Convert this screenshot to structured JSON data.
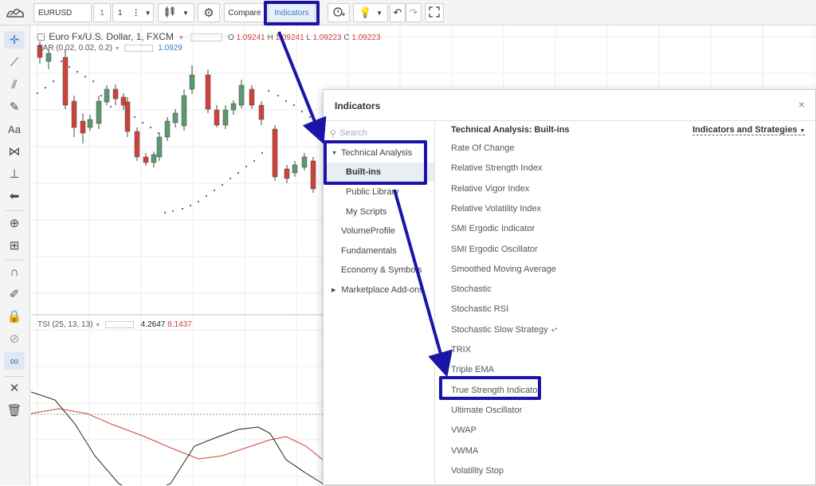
{
  "toolbar": {
    "symbol": "EURUSD",
    "interval_1": "1",
    "interval_2": "1",
    "compare_label": "Compare",
    "indicators_label": "Indicators"
  },
  "chart": {
    "title": "Euro Fx/U.S. Dollar, 1, FXCM",
    "open_label": "O",
    "open_value": "1.09241",
    "high_label": "H",
    "high_value": "1.09241",
    "low_label": "L",
    "low_value": "1.09223",
    "close_label": "C",
    "close_value": "1.09223",
    "sar_label": "SAR (0.02, 0.02, 0.2)",
    "sar_value": "1.0929",
    "tsi_label": "TSI (25, 13, 13)",
    "tsi_value_1": "4.2647",
    "tsi_value_2": "8.1437",
    "colors": {
      "up": "#5a9a6e",
      "down": "#d0413a",
      "sar": "#1f6f8b",
      "tsi": "#222222",
      "signal": "#d0413a"
    }
  },
  "dialog": {
    "title": "Indicators",
    "close": "×",
    "search_placeholder": "Search",
    "header": "Technical Analysis: Built-ins",
    "filter_label": "Indicators and Strategies",
    "nav": {
      "technical_analysis": "Technical Analysis",
      "built_ins": "Built-ins",
      "public_library": "Public Library",
      "my_scripts": "My Scripts",
      "volume_profile": "VolumeProfile",
      "fundamentals": "Fundamentals",
      "economy": "Economy & Symbols",
      "marketplace": "Marketplace Add-ons"
    },
    "items": [
      "Rate Of Change",
      "Relative Strength Index",
      "Relative Vigor Index",
      "Relative Volatility Index",
      "SMI Ergodic Indicator",
      "SMI Ergodic Oscillator",
      "Smoothed Moving Average",
      "Stochastic",
      "Stochastic RSI",
      "Stochastic Slow Strategy",
      "TRIX",
      "Triple EMA",
      "True Strength Indicator",
      "Ultimate Oscillator",
      "VWAP",
      "VWMA",
      "Volatility Stop"
    ],
    "strategy_badge": "+*"
  },
  "annotations": {
    "highlight_color": "#1a14a8"
  }
}
